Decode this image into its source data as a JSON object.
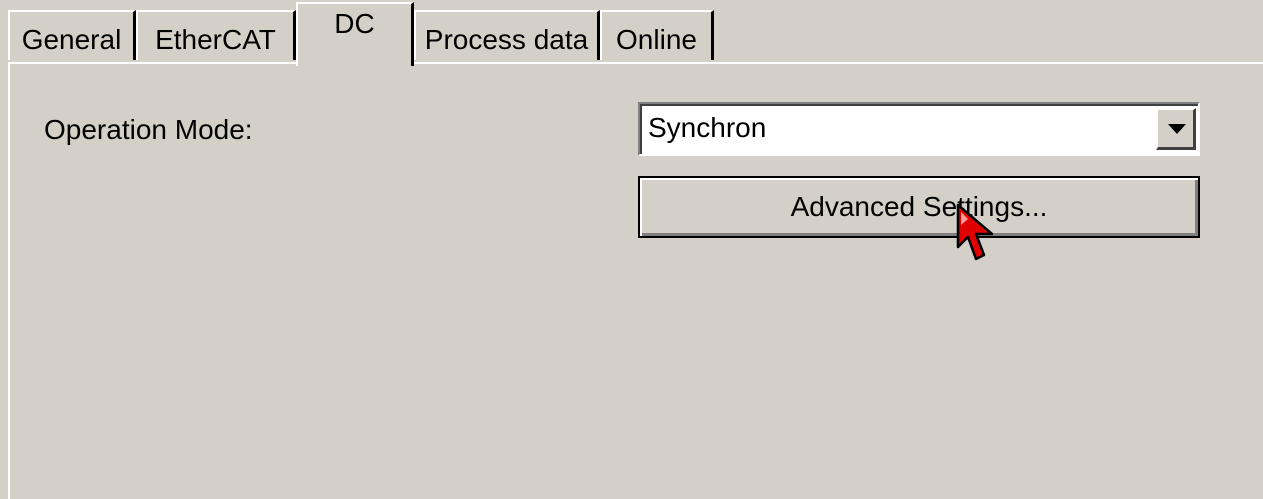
{
  "tabs": [
    {
      "label": "General"
    },
    {
      "label": "EtherCAT"
    },
    {
      "label": "DC"
    },
    {
      "label": "Process data"
    },
    {
      "label": "Online"
    }
  ],
  "active_tab": "DC",
  "operation_mode": {
    "label": "Operation Mode:",
    "value": "Synchron"
  },
  "advanced_button": {
    "label": "Advanced Settings..."
  },
  "icons": {
    "dropdown": "chevron-down-icon",
    "cursor": "mouse-pointer-icon"
  },
  "colors": {
    "face": "#d4d0c8",
    "cursor_fill": "#e00000"
  }
}
